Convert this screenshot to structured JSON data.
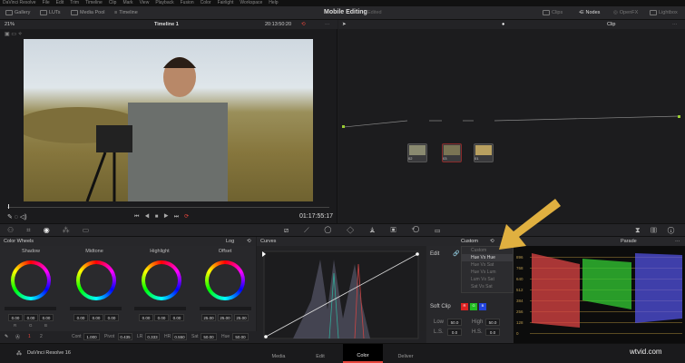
{
  "menubar": [
    "DaVinci Resolve",
    "File",
    "Edit",
    "Trim",
    "Timeline",
    "Clip",
    "Mark",
    "View",
    "Playback",
    "Fusion",
    "Color",
    "Fairlight",
    "Workspace",
    "Help"
  ],
  "toolbar": {
    "gallery": "Gallery",
    "luts": "LUTs",
    "media_pool": "Media Pool",
    "timeline": "Timeline",
    "project": "Mobile Editing",
    "status": "Edited",
    "clips": "Clips",
    "nodes": "Nodes",
    "openfx": "OpenFX",
    "lightbox": "Lightbox"
  },
  "viewer": {
    "zoom": "21%",
    "timeline": "Timeline 1",
    "timecode": "20:13:50:20",
    "playhead": "01:17:55:17"
  },
  "node_editor": {
    "mode": "Clip",
    "nodes": [
      {
        "label": "02"
      },
      {
        "label": "03"
      },
      {
        "label": "01"
      }
    ]
  },
  "color_wheels": {
    "title": "Color Wheels",
    "mode": "Log",
    "wheels": [
      {
        "name": "Shadow",
        "r": "0.00",
        "g": "0.00",
        "b": "0.00"
      },
      {
        "name": "Midtone",
        "r": "0.00",
        "g": "0.00",
        "b": "0.00"
      },
      {
        "name": "Highlight",
        "r": "0.00",
        "g": "0.00",
        "b": "0.00"
      },
      {
        "name": "Offset",
        "r": "25.00",
        "g": "25.00",
        "b": "25.00"
      }
    ],
    "channel_labels": [
      "R",
      "G",
      "B"
    ],
    "pages": [
      "1",
      "2"
    ],
    "params": {
      "cont_label": "Cont",
      "cont": "1.000",
      "pivot_label": "Pivot",
      "pivot": "0.435",
      "lr_label": "LR",
      "lr": "0.333",
      "hr_label": "HR",
      "hr": "0.550",
      "sat_label": "Sat",
      "sat": "50.00",
      "hue_label": "Hue",
      "hue": "50.00"
    }
  },
  "curves": {
    "title": "Curves",
    "mode": "Custom",
    "edit_label": "Edit",
    "menu": [
      "Custom",
      "Hue Vs Hue",
      "Hue Vs Sat",
      "Hue Vs Lum",
      "Lum Vs Sat",
      "Sat Vs Sat"
    ],
    "soft_clip": "Soft Clip",
    "r": "R",
    "g": "G",
    "b": "B",
    "low_label": "Low",
    "low": "50.0",
    "high_label": "High",
    "high": "50.0",
    "ls_label": "L.S.",
    "ls": "0.0",
    "hs_label": "H.S.",
    "hs": "0.0"
  },
  "scopes": {
    "mode": "Parade",
    "ticks": [
      "896",
      "768",
      "640",
      "512",
      "384",
      "256",
      "128",
      "0"
    ]
  },
  "footer": {
    "app": "DaVinci Resolve 16",
    "pages": [
      "Media",
      "Edit",
      "Color",
      "Deliver"
    ],
    "active": "Color",
    "watermark": "wtvid.com"
  },
  "colors": {
    "accent": "#e8453c",
    "arrow": "#e0b040"
  }
}
